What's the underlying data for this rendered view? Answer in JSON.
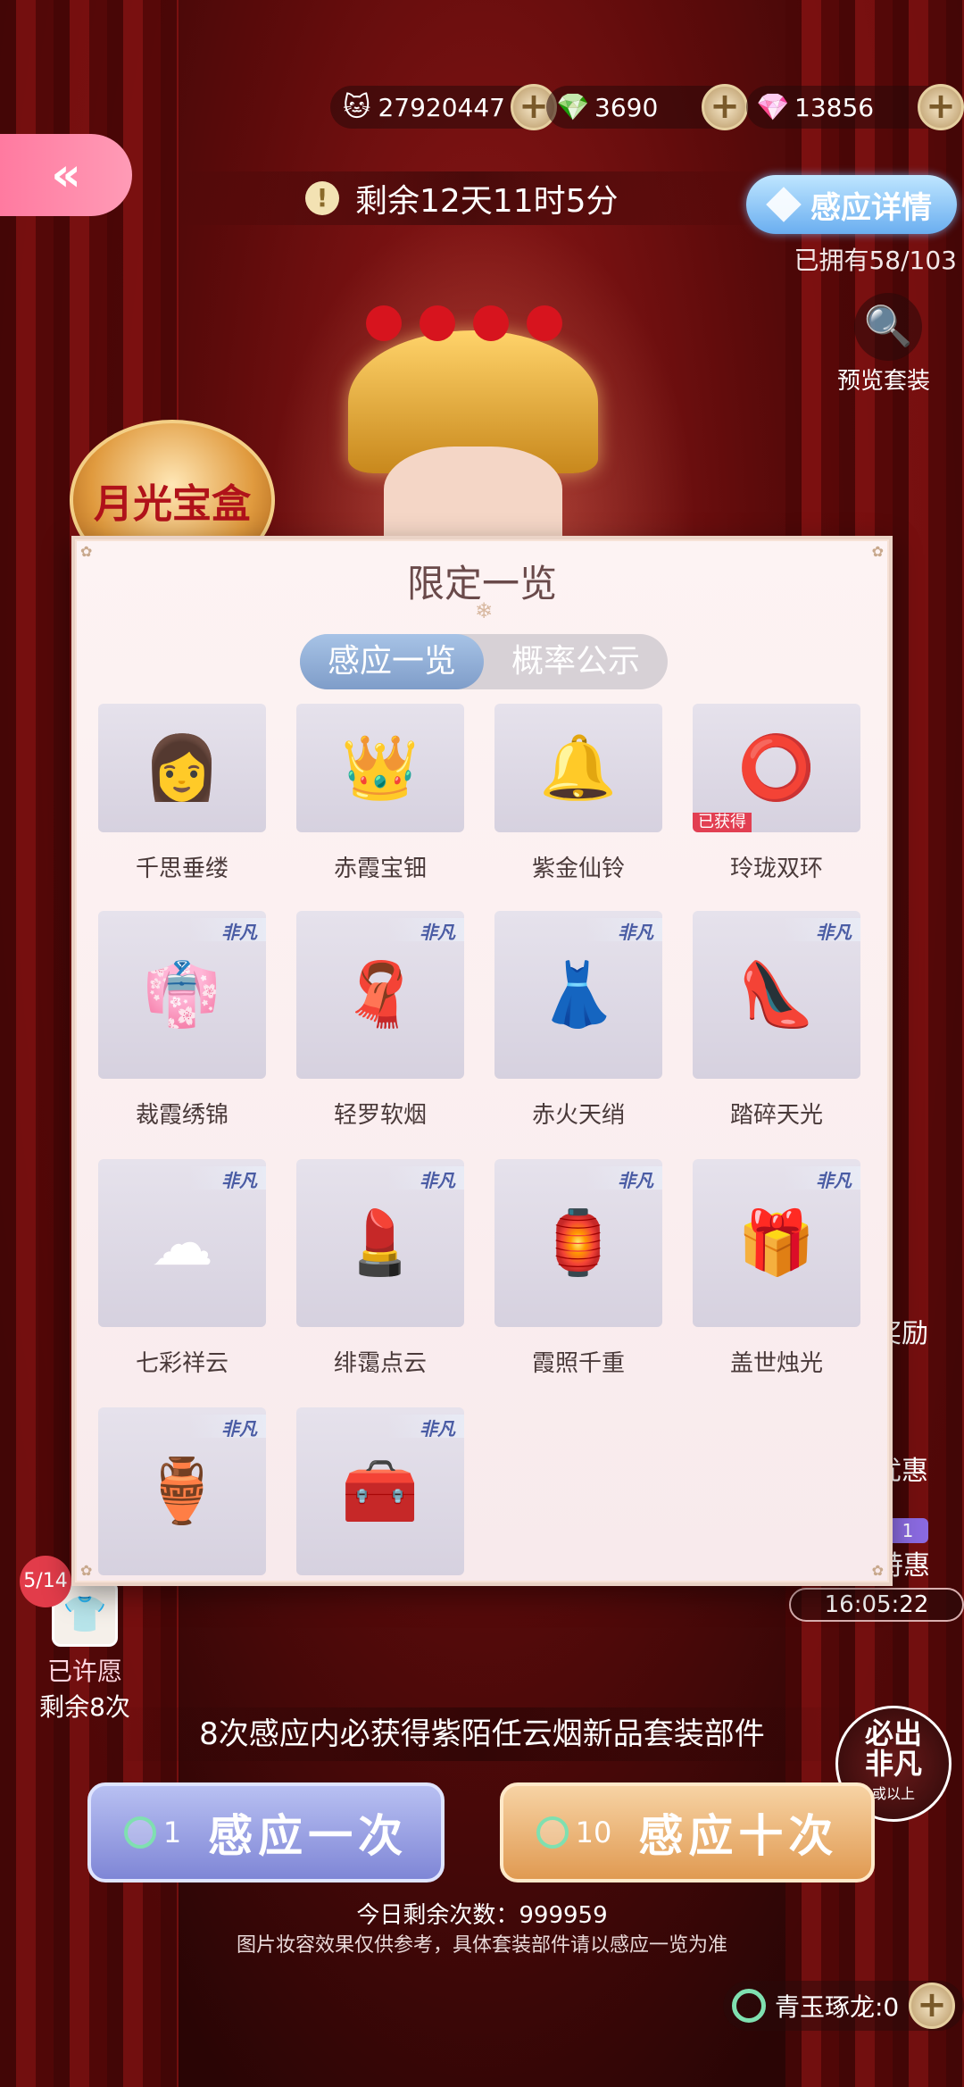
{
  "currency": [
    {
      "name": "gold-coin",
      "icon": "🐱",
      "value": "27920447"
    },
    {
      "name": "diamond",
      "icon": "💎",
      "value": "3690"
    },
    {
      "name": "pink-gem",
      "icon": "💎",
      "value": "13856"
    }
  ],
  "header": {
    "back_icon": "«",
    "timer_icon": "!",
    "timer_text": "剩余12天11时5分",
    "detail_button": "感应详情",
    "owned_text": "已拥有58/103",
    "preview_label": "预览套装",
    "preview_icon": "🔍",
    "badge_text": "月光宝盒"
  },
  "panel": {
    "title": "限定一览",
    "snow_icon": "❄",
    "tabs": [
      {
        "label": "感应一览",
        "active": true
      },
      {
        "label": "概率公示",
        "active": false
      }
    ],
    "items": [
      {
        "name": "千思垂缕",
        "art": "👩",
        "rare": false,
        "owned": false
      },
      {
        "name": "赤霞宝钿",
        "art": "👑",
        "rare": false,
        "owned": false
      },
      {
        "name": "紫金仙铃",
        "art": "🔔",
        "rare": false,
        "owned": false
      },
      {
        "name": "玲珑双环",
        "art": "⭕",
        "rare": false,
        "owned": true
      },
      {
        "name": "裁霞绣锦",
        "art": "👘",
        "rare": true,
        "owned": false
      },
      {
        "name": "轻罗软烟",
        "art": "🧣",
        "rare": true,
        "owned": false
      },
      {
        "name": "赤火天绡",
        "art": "👗",
        "rare": true,
        "owned": false
      },
      {
        "name": "踏碎天光",
        "art": "👠",
        "rare": true,
        "owned": false
      },
      {
        "name": "七彩祥云",
        "art": "☁",
        "rare": true,
        "owned": false
      },
      {
        "name": "绯霭点云",
        "art": "💄",
        "rare": true,
        "owned": false
      },
      {
        "name": "霞照千重",
        "art": "🏮",
        "rare": true,
        "owned": false
      },
      {
        "name": "盖世烛光",
        "art": "🎁",
        "rare": true,
        "owned": false
      },
      {
        "name": "",
        "art": "🏺",
        "rare": true,
        "owned": false
      },
      {
        "name": "",
        "art": "🧰",
        "rare": true,
        "owned": false
      }
    ],
    "rare_label": "非凡",
    "owned_label": "已获得"
  },
  "side": {
    "reward_label": "奖励",
    "discount_label": "优惠",
    "daily_tag": "1",
    "daily_title": "每日特惠",
    "daily_time": "16:05:22"
  },
  "wish": {
    "count": "5/14",
    "icon": "👕",
    "status": "已许愿",
    "remaining": "剩余8次"
  },
  "bottom": {
    "promo": "8次感应内必获得紫陌任云烟新品套装部件",
    "must_line1": "必出",
    "must_line2": "非凡",
    "must_line3": "或以上",
    "draw_one": {
      "cost": "1",
      "label": "感应一次"
    },
    "draw_ten": {
      "cost": "10",
      "label": "感应十次"
    },
    "remaining": "今日剩余次数：999959",
    "note": "图片妆容效果仅供参考，具体套装部件请以感应一览为准",
    "jade_label": "青玉琢龙:0"
  }
}
